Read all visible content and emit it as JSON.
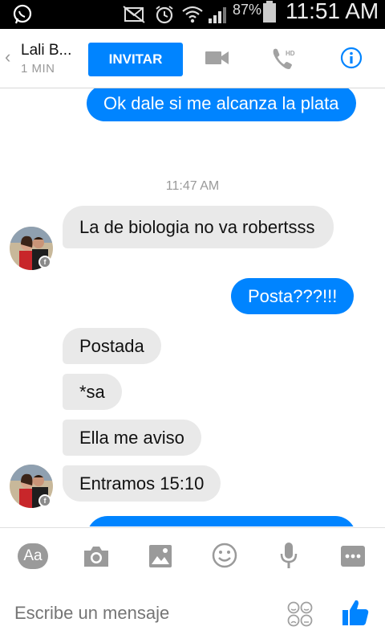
{
  "status_bar": {
    "battery_percent": "87%",
    "time": "11:51 AM"
  },
  "header": {
    "contact_name": "Lali B...",
    "contact_status": "1 MIN",
    "invite_label": "INVITAR",
    "hd_label": "HD"
  },
  "messages": {
    "m1": "Ok dale si me alcanza la plata",
    "timestamp": "11:47 AM",
    "m2": "La de biologia no va robertsss",
    "m3": "Posta???!!!",
    "m4": "Postada",
    "m5": "*sa",
    "m6": "Ella me aviso",
    "m7": "Entramos 15:10"
  },
  "toolbar": {
    "text_mode_label": "Aa"
  },
  "composer": {
    "placeholder": "Escribe un mensaje"
  },
  "colors": {
    "accent": "#0084ff",
    "incoming_bubble": "#e9e9e9",
    "icon_gray": "#9a9a9a"
  }
}
